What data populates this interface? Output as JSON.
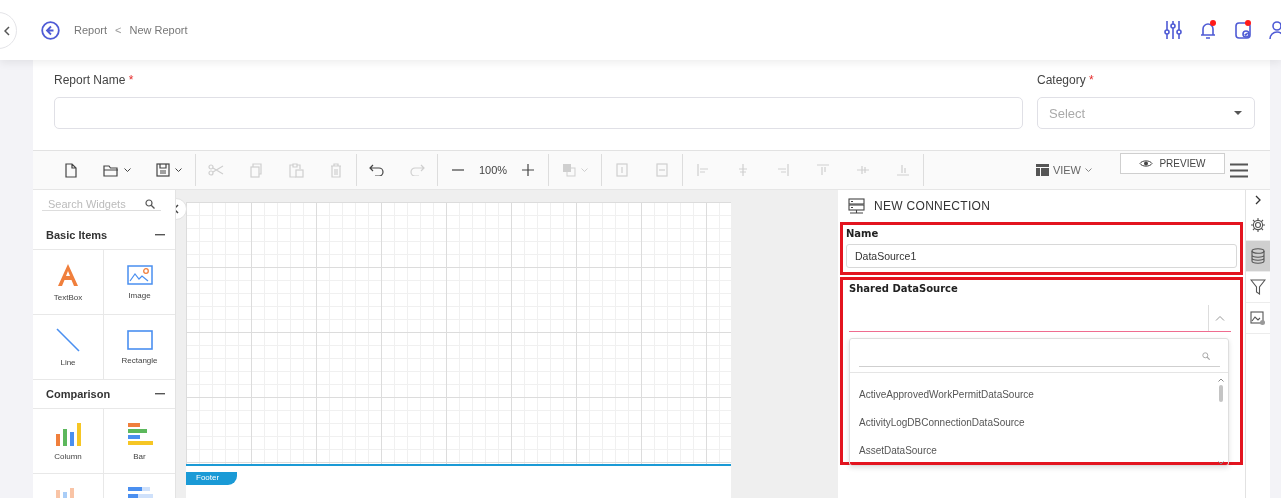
{
  "header": {
    "breadcrumb": [
      {
        "label": "Report"
      },
      {
        "label": "New Report"
      }
    ],
    "separator": "<",
    "actions": [
      {
        "kind": "sliders",
        "badge": false
      },
      {
        "kind": "bell",
        "badge": true
      },
      {
        "kind": "calendar",
        "badge": true
      },
      {
        "kind": "user",
        "badge": false
      }
    ]
  },
  "form": {
    "fields": [
      {
        "kind": "text",
        "label": "Report Name",
        "required_mark": "*"
      },
      {
        "kind": "select",
        "label": "Category",
        "required_mark": "*",
        "placeholder": "Select"
      }
    ]
  },
  "toolbar": {
    "groups": [
      [
        {
          "kind": "new",
          "disabled": false,
          "menu": false
        },
        {
          "kind": "open",
          "disabled": false,
          "menu": true
        },
        {
          "kind": "save",
          "disabled": false,
          "menu": true
        }
      ],
      [
        {
          "kind": "cut",
          "disabled": true,
          "menu": false
        },
        {
          "kind": "copy",
          "disabled": true,
          "menu": false
        },
        {
          "kind": "paste",
          "disabled": true,
          "menu": false
        },
        {
          "kind": "delete",
          "disabled": true,
          "menu": false
        }
      ],
      [
        {
          "kind": "undo",
          "disabled": false,
          "menu": false
        },
        {
          "kind": "redo",
          "disabled": true,
          "menu": false
        }
      ],
      [
        {
          "kind": "zoom-out",
          "disabled": false,
          "menu": false
        },
        {
          "kind": "zoom-level",
          "label": "100%"
        },
        {
          "kind": "zoom-in",
          "disabled": false,
          "menu": false
        }
      ],
      [
        {
          "kind": "order",
          "disabled": true,
          "menu": true
        }
      ],
      [
        {
          "kind": "insert-row",
          "disabled": true,
          "menu": false
        },
        {
          "kind": "remove-row",
          "disabled": true,
          "menu": false
        }
      ],
      [
        {
          "kind": "align-left",
          "disabled": true,
          "menu": false
        },
        {
          "kind": "align-center",
          "disabled": true,
          "menu": false
        },
        {
          "kind": "align-right",
          "disabled": true,
          "menu": false
        },
        {
          "kind": "align-top",
          "disabled": true,
          "menu": false
        },
        {
          "kind": "align-middle",
          "disabled": true,
          "menu": false
        },
        {
          "kind": "align-bottom",
          "disabled": true,
          "menu": false
        }
      ]
    ],
    "view": "VIEW",
    "preview": "PREVIEW"
  },
  "widgets": {
    "search": {
      "placeholder": "Search Widgets"
    },
    "sections": [
      {
        "title": "Basic Items",
        "expanded": true,
        "items": [
          {
            "kind": "textbox",
            "label": "TextBox"
          },
          {
            "kind": "image",
            "label": "Image"
          },
          {
            "kind": "line",
            "label": "Line"
          },
          {
            "kind": "rectangle",
            "label": "Rectangle"
          }
        ]
      },
      {
        "title": "Comparison",
        "expanded": true,
        "items": [
          {
            "kind": "column",
            "label": "Column"
          },
          {
            "kind": "bar",
            "label": "Bar"
          },
          {
            "kind": "stacked-column"
          },
          {
            "kind": "stacked-bar"
          }
        ]
      }
    ]
  },
  "canvas": {
    "band": "Footer"
  },
  "connection": {
    "title": "NEW CONNECTION",
    "name": {
      "label": "Name",
      "value": "DataSource1",
      "highlighted": true
    },
    "shared": {
      "label": "Shared DataSource",
      "highlighted": true,
      "expanded": true,
      "options": [
        "ActiveApprovedWorkPermitDataSource",
        "ActivityLogDBConnectionDataSource",
        "AssetDataSource"
      ]
    }
  },
  "side_tabs": [
    {
      "kind": "properties",
      "selected": false
    },
    {
      "kind": "data",
      "selected": true
    },
    {
      "kind": "filter",
      "selected": false
    },
    {
      "kind": "image-settings",
      "selected": false
    }
  ]
}
